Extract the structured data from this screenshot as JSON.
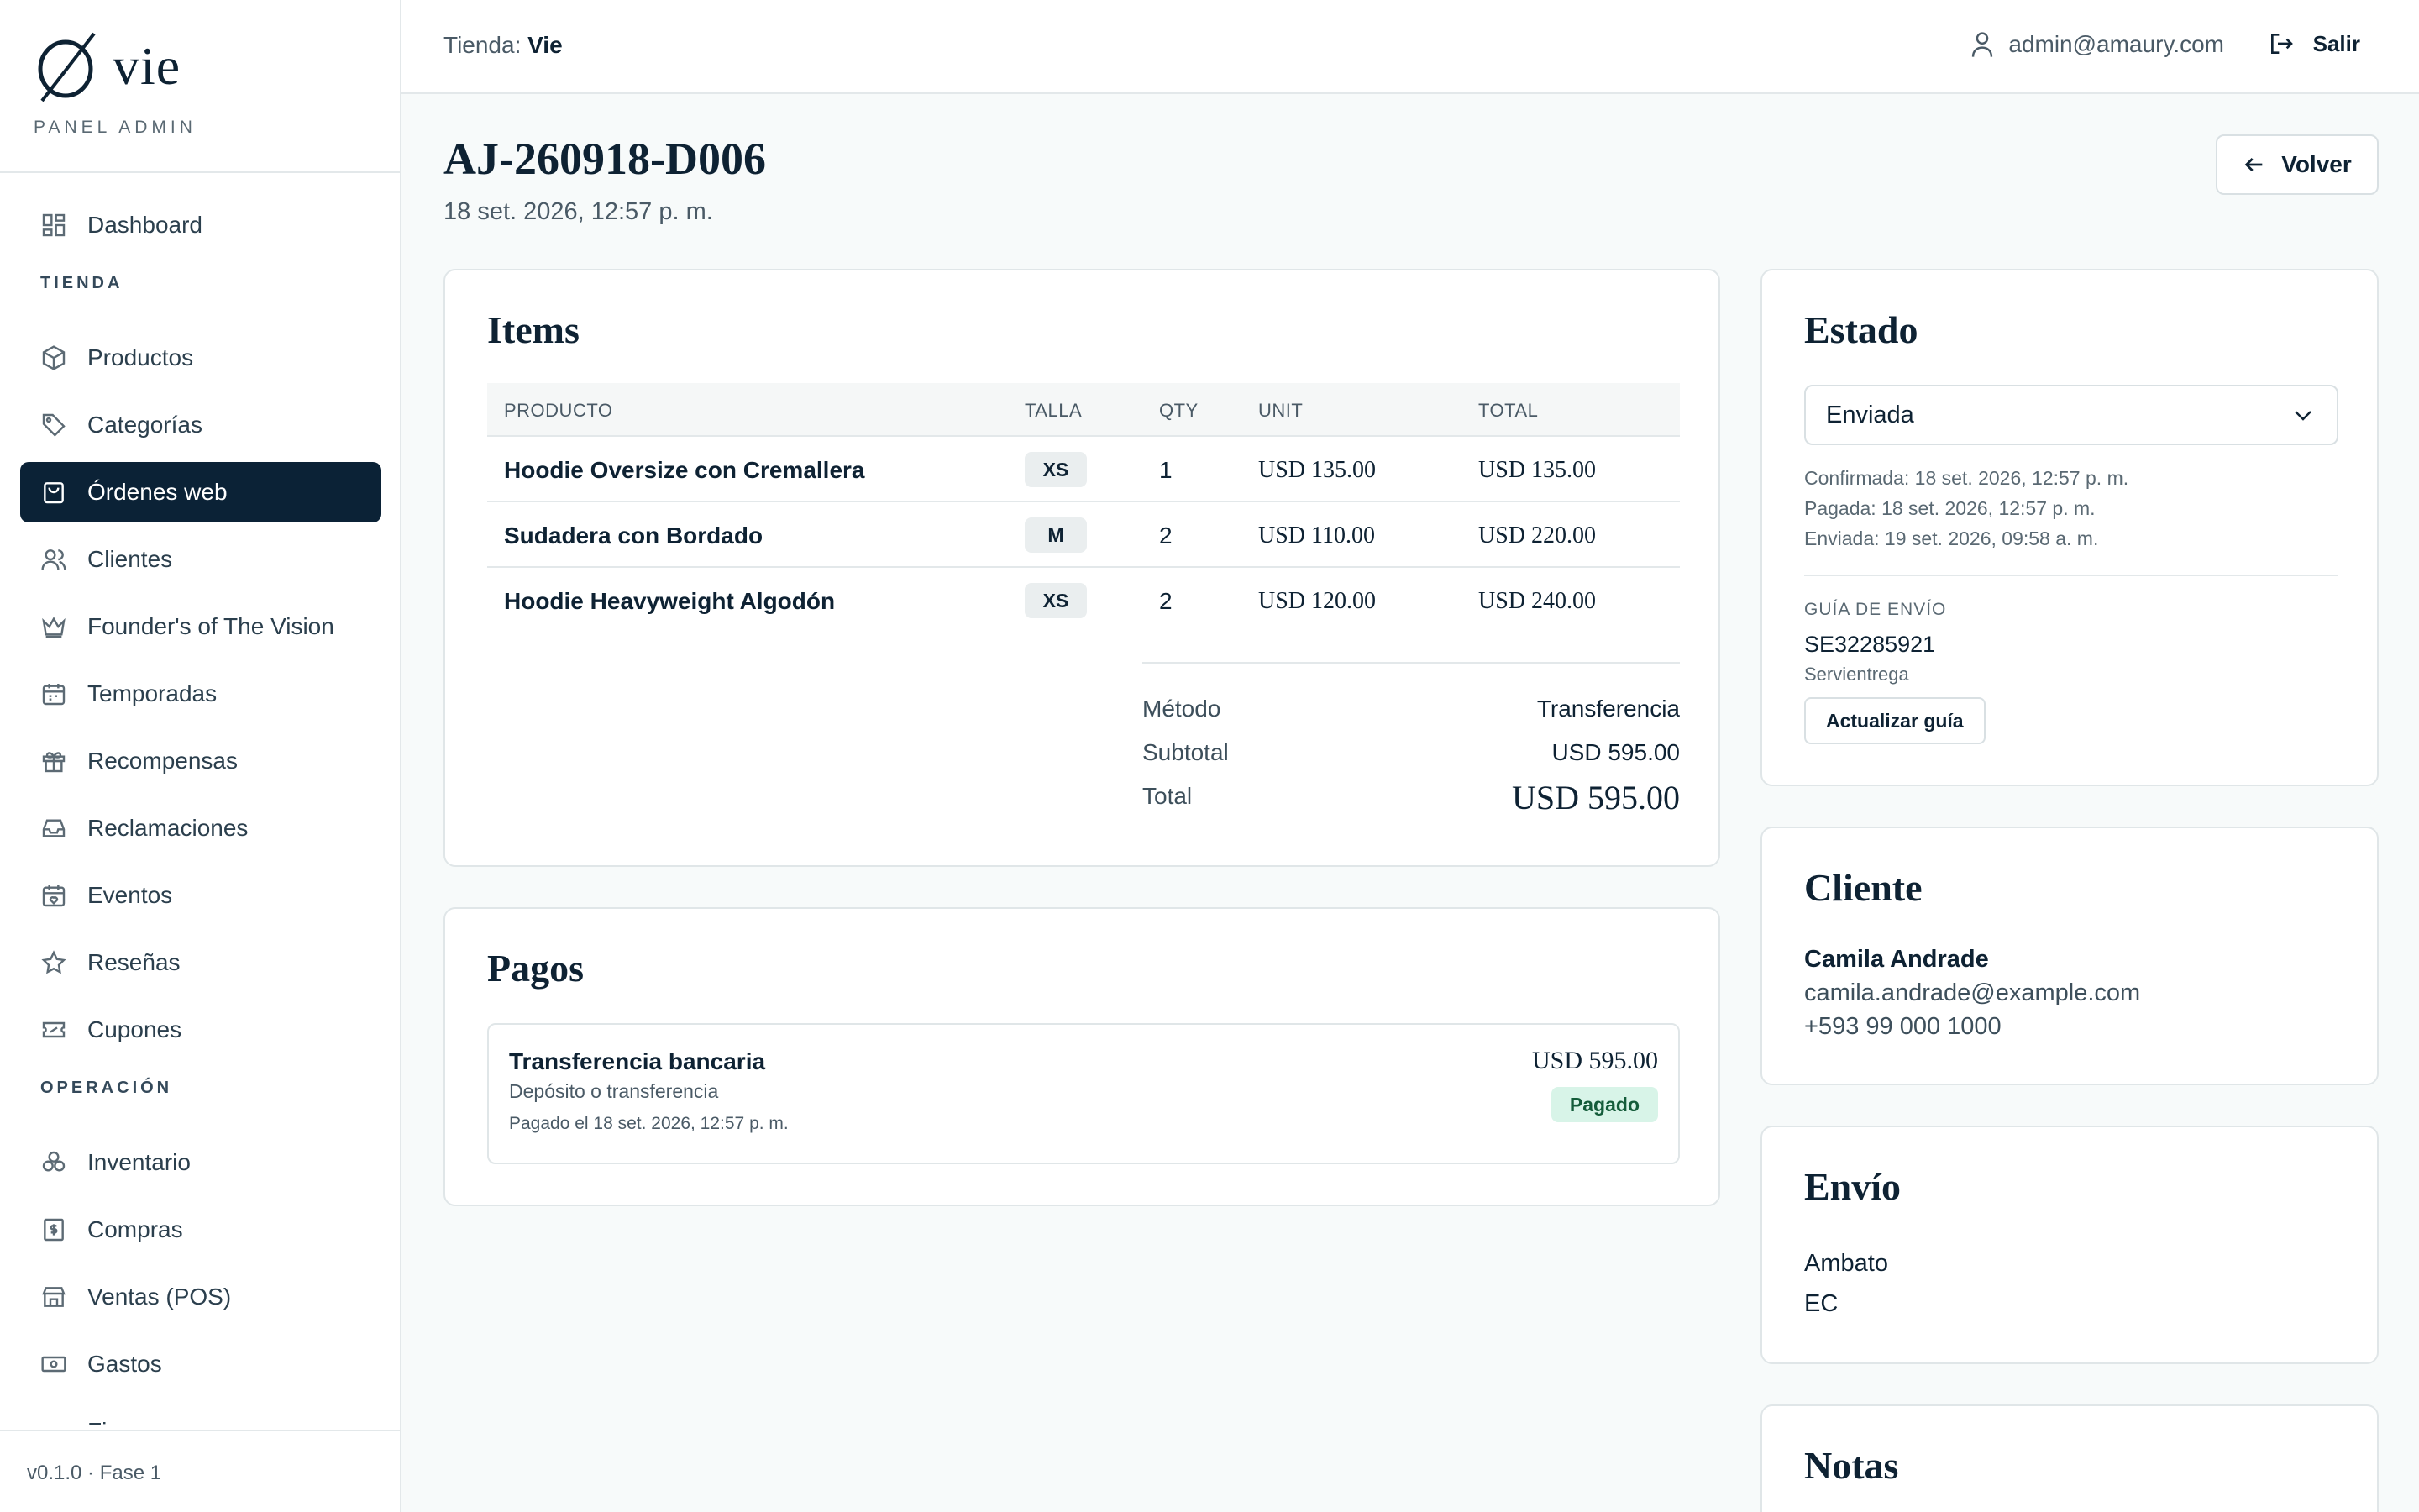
{
  "brand": {
    "name": "vie",
    "subtitle": "PANEL ADMIN"
  },
  "sidebar": {
    "items": [
      {
        "label": "Dashboard",
        "icon": "dashboard-icon"
      },
      {
        "label": "Productos",
        "icon": "box-icon"
      },
      {
        "label": "Categorías",
        "icon": "tag-icon"
      },
      {
        "label": "Órdenes web",
        "icon": "shopping-bag-icon",
        "active": true
      },
      {
        "label": "Clientes",
        "icon": "users-icon"
      },
      {
        "label": "Founder's of The Vision",
        "icon": "crown-icon"
      },
      {
        "label": "Temporadas",
        "icon": "calendar-icon"
      },
      {
        "label": "Recompensas",
        "icon": "gift-icon"
      },
      {
        "label": "Reclamaciones",
        "icon": "inbox-icon"
      },
      {
        "label": "Eventos",
        "icon": "calendar-heart-icon"
      },
      {
        "label": "Reseñas",
        "icon": "star-icon"
      },
      {
        "label": "Cupones",
        "icon": "ticket-icon"
      },
      {
        "label": "Inventario",
        "icon": "boxes-icon"
      },
      {
        "label": "Compras",
        "icon": "receipt-dollar-icon"
      },
      {
        "label": "Ventas (POS)",
        "icon": "store-icon"
      },
      {
        "label": "Gastos",
        "icon": "banknote-icon"
      },
      {
        "label": "Finanzas",
        "icon": "trending-up-icon"
      }
    ],
    "sections": {
      "tienda": "TIENDA",
      "operacion": "OPERACIÓN"
    },
    "version": "v0.1.0 · Fase 1"
  },
  "topbar": {
    "store_prefix": "Tienda:",
    "store_name": "Vie",
    "user_email": "admin@amaury.com",
    "logout_label": "Salir"
  },
  "order": {
    "id": "AJ-260918-D006",
    "date": "18 set. 2026, 12:57 p. m.",
    "back_label": "Volver"
  },
  "items_card": {
    "title": "Items",
    "columns": [
      "PRODUCTO",
      "TALLA",
      "QTY",
      "UNIT",
      "TOTAL"
    ],
    "rows": [
      {
        "product": "Hoodie Oversize con Cremallera",
        "size": "XS",
        "qty": "1",
        "unit": "USD 135.00",
        "total": "USD 135.00"
      },
      {
        "product": "Sudadera con Bordado",
        "size": "M",
        "qty": "2",
        "unit": "USD 110.00",
        "total": "USD 220.00"
      },
      {
        "product": "Hoodie Heavyweight Algodón",
        "size": "XS",
        "qty": "2",
        "unit": "USD 120.00",
        "total": "USD 240.00"
      }
    ],
    "summary": {
      "method_label": "Método",
      "method_value": "Transferencia",
      "subtotal_label": "Subtotal",
      "subtotal_value": "USD 595.00",
      "total_label": "Total",
      "total_value": "USD 595.00"
    }
  },
  "payments_card": {
    "title": "Pagos",
    "payment": {
      "name": "Transferencia bancaria",
      "description": "Depósito o transferencia",
      "paid_on": "Pagado el 18 set. 2026, 12:57 p. m.",
      "amount": "USD 595.00",
      "status": "Pagado"
    }
  },
  "status_card": {
    "title": "Estado",
    "selected": "Enviada",
    "history": [
      "Confirmada: 18 set. 2026, 12:57 p. m.",
      "Pagada: 18 set. 2026, 12:57 p. m.",
      "Enviada: 19 set. 2026, 09:58 a. m."
    ],
    "guide_label": "GUÍA DE ENVÍO",
    "guide_number": "SE32285921",
    "carrier": "Servientrega",
    "update_button": "Actualizar guía"
  },
  "client_card": {
    "title": "Cliente",
    "name": "Camila Andrade",
    "email": "camila.andrade@example.com",
    "phone": "+593 99 000 1000"
  },
  "shipping_card": {
    "title": "Envío",
    "city": "Ambato",
    "country": "EC"
  },
  "notes_card": {
    "title": "Notas"
  },
  "colors": {
    "primary": "#0b2236",
    "success_bg": "#d8f4e8",
    "success_text": "#145c3a"
  }
}
